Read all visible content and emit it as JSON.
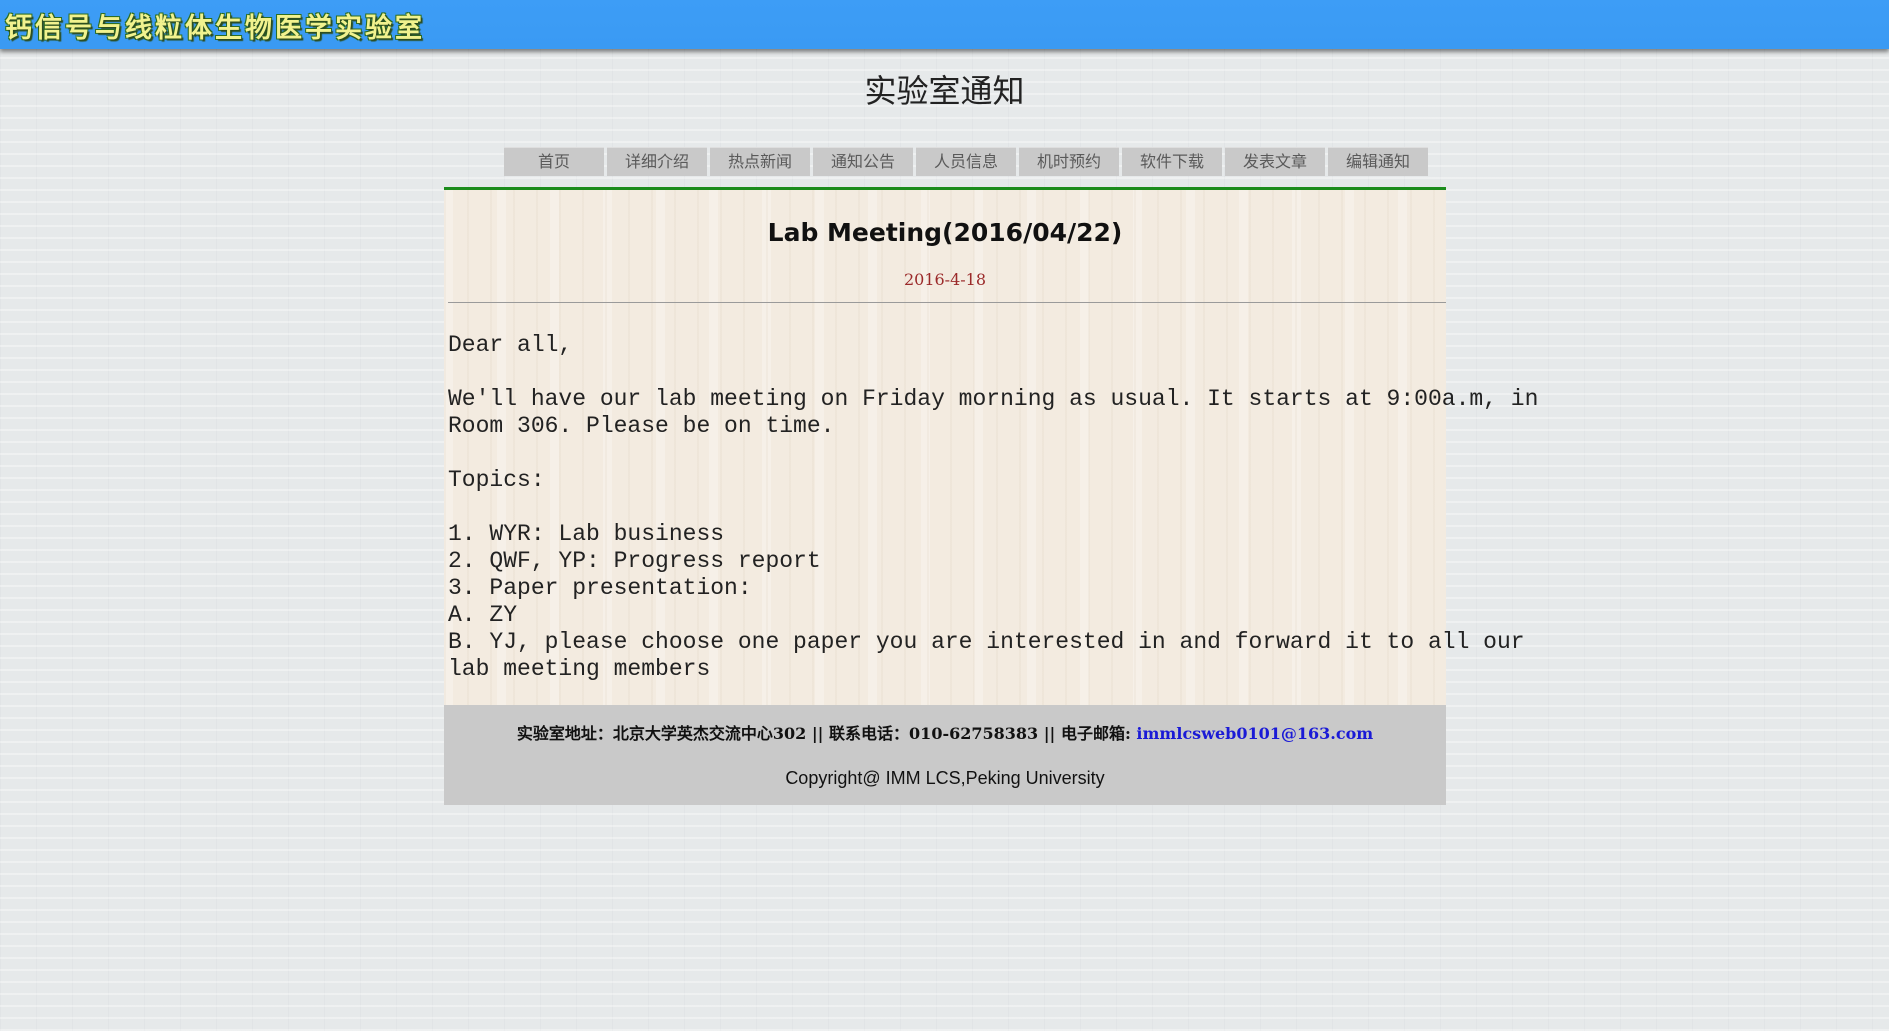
{
  "banner": {
    "title": "钙信号与线粒体生物医学实验室"
  },
  "page": {
    "heading": "实验室通知"
  },
  "nav": {
    "items": [
      {
        "label": "首页"
      },
      {
        "label": "详细介绍"
      },
      {
        "label": "热点新闻"
      },
      {
        "label": "通知公告"
      },
      {
        "label": "人员信息"
      },
      {
        "label": "机时预约"
      },
      {
        "label": "软件下载"
      },
      {
        "label": "发表文章"
      },
      {
        "label": "编辑通知"
      }
    ]
  },
  "notice": {
    "title": "Lab Meeting(2016/04/22)",
    "date": "2016-4-18",
    "body_lines": [
      "Dear all,",
      "",
      "We'll have our lab meeting on Friday morning as usual. It starts at 9:00a.m, in",
      "Room 306. Please be on time.",
      "",
      "Topics:",
      "",
      "1. WYR: Lab business",
      "2. QWF, YP: Progress report",
      "3. Paper presentation:",
      "A. ZY",
      "B. YJ, please choose one paper you are interested in and forward it to all our",
      "lab meeting members"
    ]
  },
  "footer": {
    "address_label": "实验室地址：",
    "address": "北京大学英杰交流中心302",
    "separator1": " || ",
    "phone_label": "联系电话：",
    "phone": "010-62758383",
    "separator2": " ||   ",
    "email_label": "电子邮箱: ",
    "email": "immlcsweb0101@163.com",
    "copyright": "Copyright@ IMM LCS,Peking University"
  },
  "colors": {
    "banner": "#3a9af3",
    "banner_text": "#f1f28e",
    "accent_line": "#1c8c1c",
    "date_text": "#9b2a2a",
    "email_link": "#1a1ad6",
    "nav_bg": "#c9c9c9"
  }
}
